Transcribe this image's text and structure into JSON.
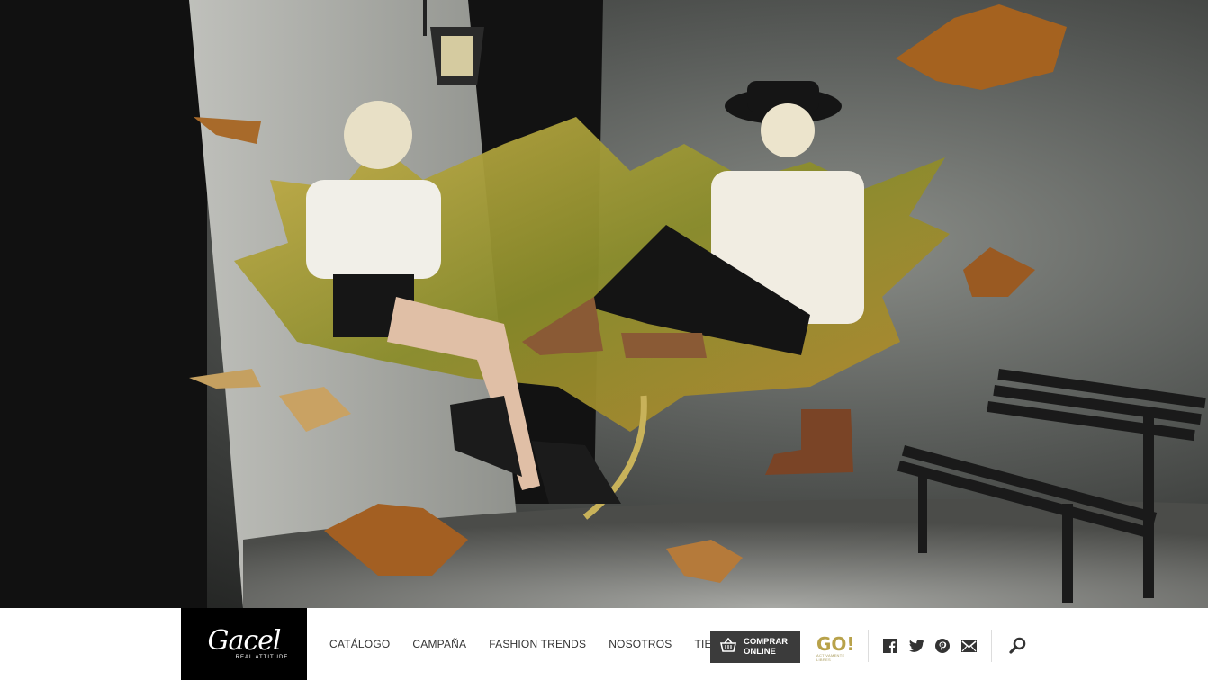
{
  "brand": {
    "logo": "Gacel",
    "tagline": "REAL ATTITUDE"
  },
  "nav": {
    "items": [
      {
        "label": "CATÁLOGO"
      },
      {
        "label": "CAMPAÑA"
      },
      {
        "label": "FASHION TRENDS"
      },
      {
        "label": "NOSOTROS"
      },
      {
        "label": "TIENDAS"
      }
    ]
  },
  "shop": {
    "line1": "COMPRAR",
    "line2": "ONLINE",
    "icon": "basket-icon"
  },
  "go": {
    "label": "GO!",
    "sub": "ACTIVAMENTE LIBRES"
  },
  "social": [
    "facebook-icon",
    "twitter-icon",
    "pinterest-icon",
    "email-icon"
  ],
  "search": {
    "icon": "search-icon"
  },
  "colors": {
    "nav_bg": "#ffffff",
    "logo_bg": "#000000",
    "button_bg": "#3b3b3b",
    "go_gold": "#b8a24a",
    "text": "#333333"
  }
}
